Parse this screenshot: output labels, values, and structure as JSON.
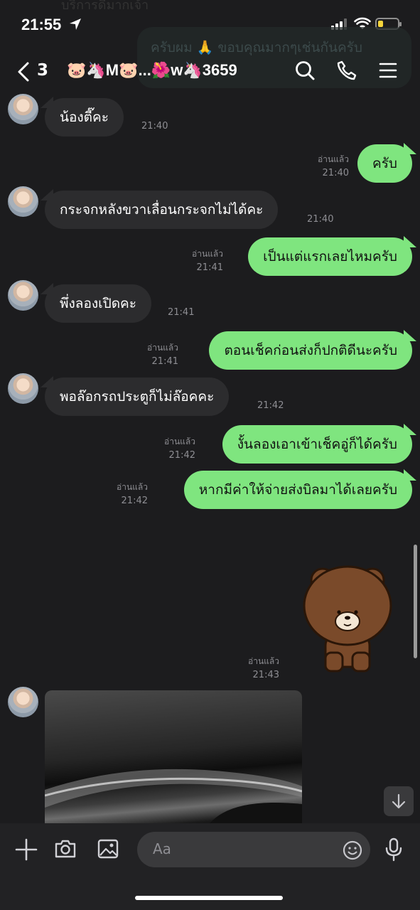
{
  "status_bar": {
    "time": "21:55"
  },
  "background_preview": {
    "ghost_message": "ครับผม 🙏 ขอบคุณมากๆเช่นกันครับ",
    "ghost_top": "บริการดีมากเจ้า"
  },
  "header": {
    "unread_count": "3",
    "chat_title": "🐷🦄M🐷...🌺w🦄3659"
  },
  "messages": [
    {
      "dir": "in",
      "text": "น้องตี๊คะ",
      "time": "21:40"
    },
    {
      "dir": "out",
      "text": "ครับ",
      "read": "อ่านแล้ว",
      "time": "21:40"
    },
    {
      "dir": "in",
      "text": "กระจกหลังขวาเลื่อนกระจกไม่ได้คะ",
      "time": "21:40"
    },
    {
      "dir": "out",
      "text": "เป็นแต่แรกเลยไหมครับ",
      "read": "อ่านแล้ว",
      "time": "21:41"
    },
    {
      "dir": "in",
      "text": "พึ่งลองเปิดคะ",
      "time": "21:41"
    },
    {
      "dir": "out",
      "text": "ตอนเช็คก่อนส่งก็ปกติดีนะครับ",
      "read": "อ่านแล้ว",
      "time": "21:41"
    },
    {
      "dir": "in",
      "text": "พอล๊อกรถประตูก็ไม่ล๊อคคะ",
      "time": "21:42"
    },
    {
      "dir": "out",
      "text": "งั้นลองเอาเข้าเช็คอู่ก็ได้ครับ",
      "read": "อ่านแล้ว",
      "time": "21:42"
    },
    {
      "dir": "out",
      "text": "หากมีค่าให้จ่ายส่งบิลมาได้เลยครับ",
      "read": "อ่านแล้ว",
      "time": "21:42"
    }
  ],
  "sticker": {
    "read": "อ่านแล้ว",
    "time": "21:43",
    "icon": "brown-bear-sticker"
  },
  "input_bar": {
    "placeholder": "Aa"
  },
  "colors": {
    "incoming_bubble": "#2c2c2e",
    "outgoing_bubble": "#7fe57f",
    "background": "#1c1c1e"
  }
}
